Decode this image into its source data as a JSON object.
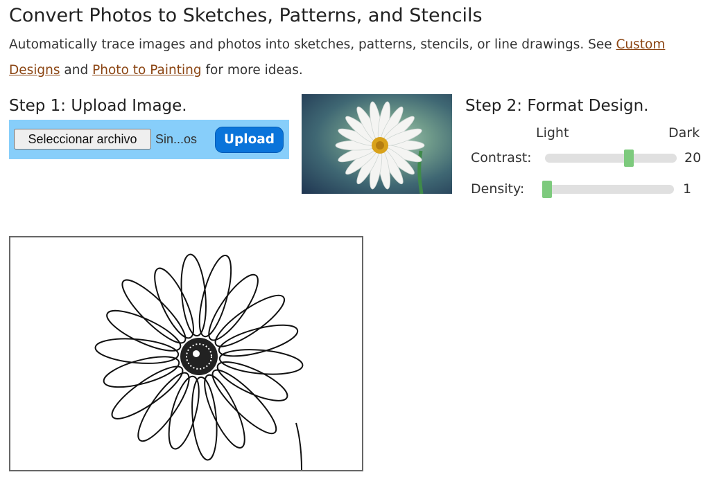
{
  "header": {
    "title": "Convert Photos to Sketches, Patterns, and Stencils",
    "intro_text": "Automatically trace images and photos into sketches, patterns, stencils, or line drawings. See",
    "link_custom_designs": "Custom Designs",
    "and_text": "and",
    "link_photo_to_painting": "Photo to Painting",
    "more_text": "for more ideas."
  },
  "step1": {
    "heading": "Step 1: Upload Image.",
    "file_button_label": "Seleccionar archivo",
    "file_status": "Sin...os",
    "upload_label": "Upload"
  },
  "step2": {
    "heading": "Step 2: Format Design.",
    "light_label": "Light",
    "dark_label": "Dark",
    "contrast": {
      "label": "Contrast:",
      "value": "20",
      "level": 0.65
    },
    "density": {
      "label": "Density:",
      "value": "1",
      "level": 0.0
    }
  },
  "colors": {
    "upload_bar": "#87cefa",
    "upload_button": "#0a74da",
    "link": "#8b4513",
    "slider_thumb": "#7dca7d",
    "slider_track": "#e0e0e0"
  },
  "icons": {
    "preview_image": "daisy-photo-image",
    "sketch_image": "daisy-line-drawing-image"
  }
}
